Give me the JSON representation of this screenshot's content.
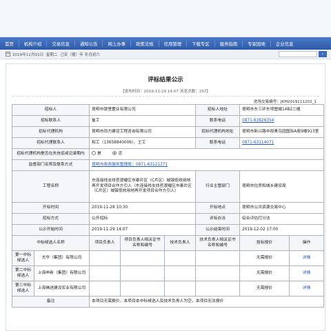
{
  "nav": [
    "首页",
    "机构介绍",
    "交易信息",
    "通知公告",
    "网上办事",
    "政策法规",
    "信用管理",
    "下载专区",
    "服务指南",
    "专家园地",
    "企业信息"
  ],
  "datebar": {
    "date": "2019年12月01日",
    "weekday": "星期二",
    "lunar": "己亥（猪）年 冬月初六"
  },
  "search": {
    "button": "›"
  },
  "notice": {
    "title": "评标结果公示",
    "meta": "【发布时间：2019-11-29 14:07  浏览次数：297】",
    "trade_code": "进场交易编号：JKM2019111202_1"
  },
  "table": {
    "labels": {
      "tenderer": "招标人",
      "tenderer_addr": "招标人地址",
      "tenderer_contact": "招标联系人",
      "tenderer_phone": "联系电话",
      "agency": "招标代理机构",
      "agency_addr": "招标代理机构地址",
      "agency_contact": "招标代理联系人",
      "agency_phone": "联系电话",
      "bad_record": "招标代理机构是否在失信惩戒记录期内",
      "supervisor": "监督部门名称及联系方式",
      "project": "工程名称",
      "dept": "行业主管部门",
      "open_time": "开标时间",
      "open_place": "开标地点",
      "method": "招标方式",
      "eval_method": "评标办法",
      "pub_start": "公示开始时间",
      "pub_end": "公示结束时间"
    },
    "values": {
      "tenderer": "昆明市银里置业有限公司",
      "tenderer_addr": "昆明市东三环东坝塑城14B2二楼",
      "tenderer_contact": "崔工",
      "tenderer_phone": "0871-63826354",
      "agency": "昆明市同力建设工程咨询有限公司",
      "agency_addr": "昆明市新兴路中段青鸟园国际A座9楼913室",
      "agency_contact": "和工（13658840006）、王工",
      "agency_phone": "0871-63114071",
      "bad_yes": "是",
      "bad_no": "否",
      "supervisor": "昆明市政务服务管理局：0871-63121371",
      "project": "东连接线支线官渡耀区市泰片区（C片区）城镇低效用地再开发项目合作方引入（东连接线支线官渡耀区市泰片区（C片区）城镇低效用地再开发项目合作方引入）",
      "dept": "昆明市住房和城乡建设局",
      "open_time": "2019-11-28 10:30",
      "open_place": "昆明市公共资源交易中心",
      "method": "公开招标",
      "eval_method": "综合评估打分法",
      "pub_start": "2019-11-29 14:07",
      "pub_end": "2019-12-02 17:00"
    },
    "cand_headers": [
      "中标候选人名称",
      "项目负责人",
      "项目负责人相关证书名称和编号",
      "技术负责人",
      "技术负责人相关证书名称和编号",
      "投标报价",
      "操作"
    ],
    "candidates": [
      {
        "rank": "第一中标候选人",
        "name": "大华（集团）有限公司",
        "price": "无需报价",
        "op": "详情"
      },
      {
        "rank": "第二中标候选人",
        "name": "上海申新（集团）有限公司",
        "price": "无需报价",
        "op": "详情"
      },
      {
        "rank": "第三中标候选人",
        "name": "上海佛进建设实业有限公司",
        "price": "无需报价",
        "op": "详情"
      }
    ],
    "remarks_label": "备注",
    "remarks": "本项目无需报价，本项目本中标候选人及技术负责人为空，本项目无法报价"
  }
}
